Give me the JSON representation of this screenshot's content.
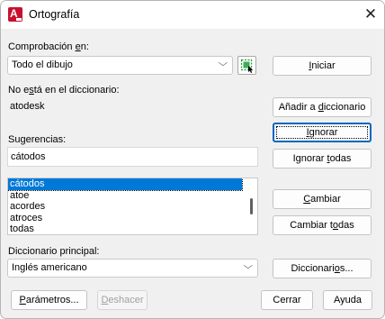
{
  "window": {
    "title": "Ortografía",
    "close_glyph": "✕",
    "app_icon_letter": "A"
  },
  "check_in": {
    "label_pre": "Comprobación ",
    "label_key": "e",
    "label_post": "n:",
    "value": "Todo el dibujo"
  },
  "not_in_dict": {
    "label_pre": "No e",
    "label_key": "s",
    "label_post": "tá en el diccionario:",
    "value": "atodesk"
  },
  "suggestions": {
    "label_pre": "Su",
    "label_key": "g",
    "label_post": "erencias:",
    "value": "cátodos",
    "items": [
      "cátodos",
      "atoe",
      "acordes",
      "atroces",
      "todas"
    ],
    "selected_index": 0
  },
  "main_dictionary": {
    "label": "Diccionario principal:",
    "value": "Inglés americano"
  },
  "buttons": {
    "start": {
      "pre": "",
      "key": "I",
      "post": "niciar"
    },
    "add_to_dict": {
      "pre": "Añadir a ",
      "key": "d",
      "post": "iccionario"
    },
    "ignore": {
      "pre": "",
      "key": "I",
      "post": "gnorar"
    },
    "ignore_all": {
      "pre": "Ignorar ",
      "key": "t",
      "post": "odas"
    },
    "change": {
      "pre": "",
      "key": "C",
      "post": "ambiar"
    },
    "change_all": {
      "pre": "Cambiar t",
      "key": "o",
      "post": "das"
    },
    "dictionaries": {
      "pre": "Diccionari",
      "key": "o",
      "post": "s..."
    },
    "parameters": {
      "pre": "",
      "key": "P",
      "post": "arámetros..."
    },
    "undo": {
      "pre": "",
      "key": "D",
      "post": "eshacer"
    },
    "close": {
      "pre": "",
      "key": "",
      "post": "Cerrar"
    },
    "help": {
      "pre": "",
      "key": "",
      "post": "Ayuda"
    }
  },
  "colors": {
    "accent": "#0067c0",
    "selection": "#0078d7",
    "app_icon": "#c8102e",
    "pick_icon": "#1f9d3a"
  }
}
